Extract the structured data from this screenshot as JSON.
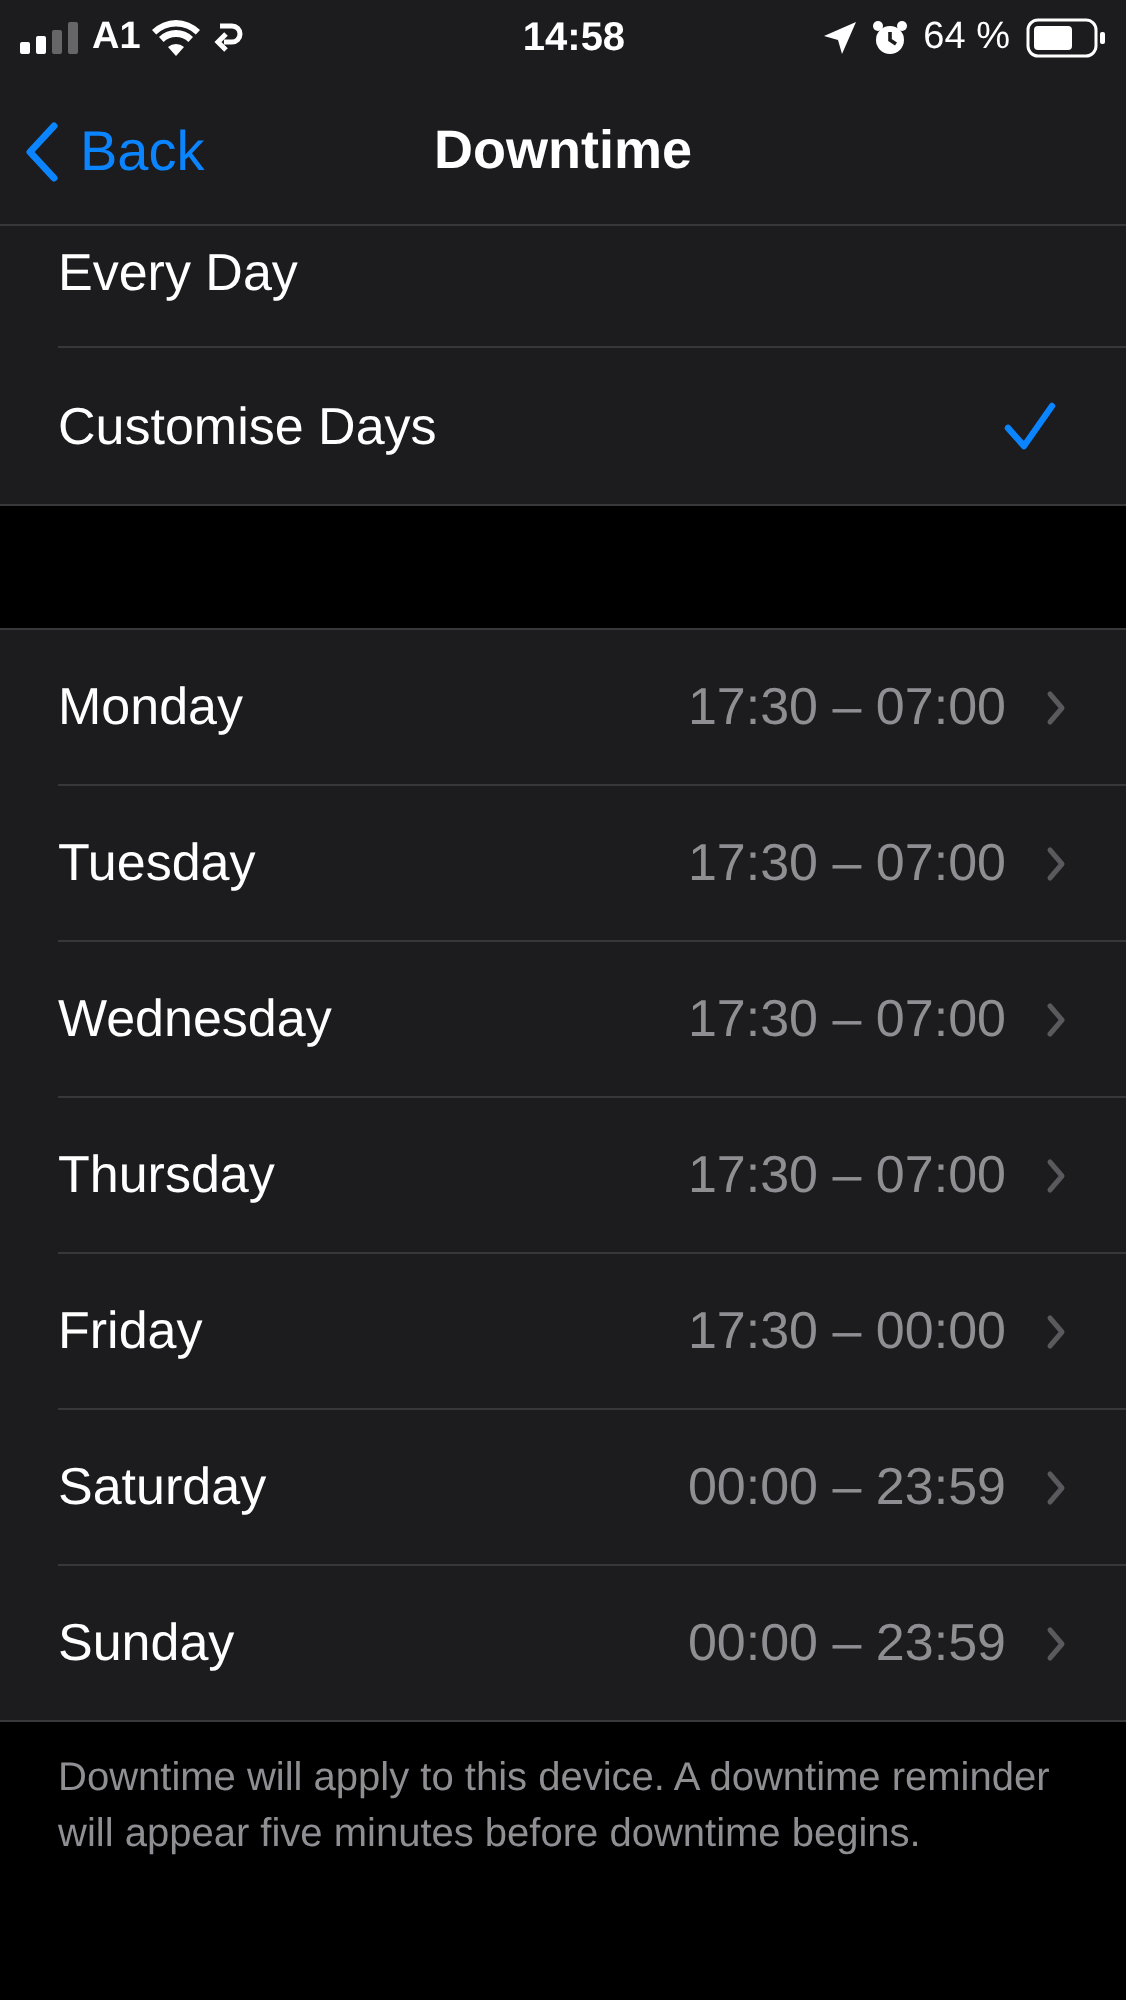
{
  "status_bar": {
    "carrier": "A1",
    "time": "14:58",
    "battery": "64 %"
  },
  "nav": {
    "back": "Back",
    "title": "Downtime"
  },
  "options": [
    {
      "label": "Every Day",
      "selected": false
    },
    {
      "label": "Customise Days",
      "selected": true
    }
  ],
  "days": [
    {
      "name": "Monday",
      "time": "17:30 – 07:00"
    },
    {
      "name": "Tuesday",
      "time": "17:30 – 07:00"
    },
    {
      "name": "Wednesday",
      "time": "17:30 – 07:00"
    },
    {
      "name": "Thursday",
      "time": "17:30 – 07:00"
    },
    {
      "name": "Friday",
      "time": "17:30 – 00:00"
    },
    {
      "name": "Saturday",
      "time": "00:00 – 23:59"
    },
    {
      "name": "Sunday",
      "time": "00:00 – 23:59"
    }
  ],
  "footer": "Downtime will apply to this device. A downtime reminder will appear five minutes before downtime begins."
}
